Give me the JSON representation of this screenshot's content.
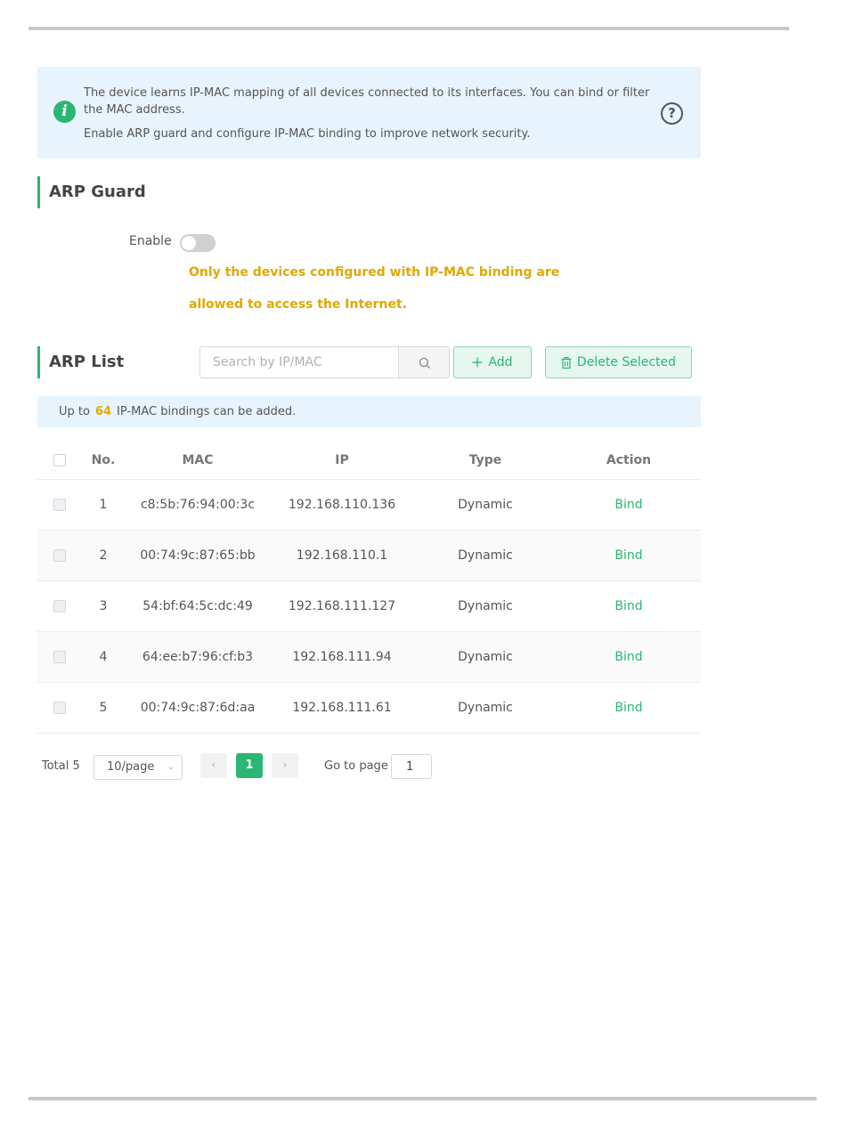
{
  "info": {
    "line1": "The device learns IP-MAC mapping of all devices connected to its interfaces. You can bind or filter the MAC address.",
    "line2": "Enable ARP guard and configure IP-MAC binding to improve network security."
  },
  "arp_guard": {
    "title": "ARP Guard",
    "enable_label": "Enable",
    "enabled": false,
    "warning_line1": "Only the devices configured with IP-MAC binding are",
    "warning_line2": "allowed to access the Internet."
  },
  "arp_list": {
    "title": "ARP List",
    "search_placeholder": "Search by IP/MAC",
    "add_label": "Add",
    "delete_label": "Delete Selected",
    "limit_prefix": "Up to",
    "limit_count": "64",
    "limit_suffix": "IP-MAC bindings can be added."
  },
  "table": {
    "headers": {
      "no": "No.",
      "mac": "MAC",
      "ip": "IP",
      "type": "Type",
      "action": "Action"
    },
    "rows": [
      {
        "no": "1",
        "mac": "c8:5b:76:94:00:3c",
        "ip": "192.168.110.136",
        "type": "Dynamic",
        "action": "Bind"
      },
      {
        "no": "2",
        "mac": "00:74:9c:87:65:bb",
        "ip": "192.168.110.1",
        "type": "Dynamic",
        "action": "Bind"
      },
      {
        "no": "3",
        "mac": "54:bf:64:5c:dc:49",
        "ip": "192.168.111.127",
        "type": "Dynamic",
        "action": "Bind"
      },
      {
        "no": "4",
        "mac": "64:ee:b7:96:cf:b3",
        "ip": "192.168.111.94",
        "type": "Dynamic",
        "action": "Bind"
      },
      {
        "no": "5",
        "mac": "00:74:9c:87:6d:aa",
        "ip": "192.168.111.61",
        "type": "Dynamic",
        "action": "Bind"
      }
    ]
  },
  "pagination": {
    "total": "Total 5",
    "page_size": "10/page",
    "current_page": "1",
    "goto_label": "Go to page",
    "goto_value": "1"
  },
  "colors": {
    "accent": "#2bb673",
    "warning": "#e0a800",
    "info_bg": "#e8f4fd"
  },
  "icons": {
    "info": "info-icon",
    "help": "question-circle-icon",
    "search": "search-icon",
    "add": "plus-icon",
    "delete": "trash-icon"
  }
}
